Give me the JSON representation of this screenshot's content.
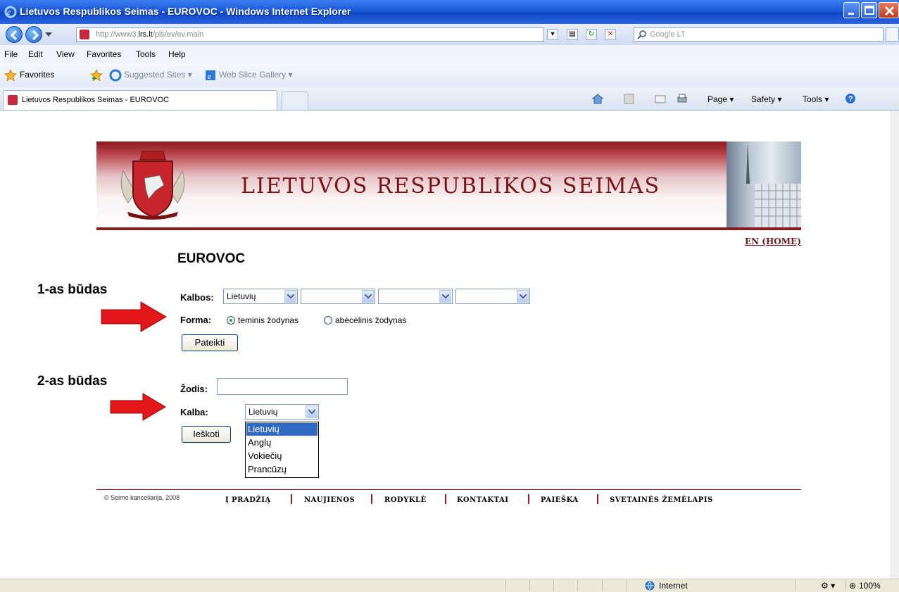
{
  "window": {
    "title": "Lietuvos Respublikos Seimas - EUROVOC - Windows Internet Explorer"
  },
  "address_bar": {
    "url_prefix": "http://www3.",
    "url_domain": "lrs.lt",
    "url_path": "/pls/ev/ev.main",
    "search_placeholder": "Google LT"
  },
  "menu": [
    "File",
    "Edit",
    "View",
    "Favorites",
    "Tools",
    "Help"
  ],
  "favorites_bar": {
    "favorites_label": "Favorites",
    "suggested_sites": "Suggested Sites ▾",
    "web_slice_gallery": "Web Slice Gallery ▾"
  },
  "tab": {
    "label": "Lietuvos Respublikos Seimas - EUROVOC"
  },
  "command_bar": {
    "page": "Page ▾",
    "safety": "Safety ▾",
    "tools": "Tools ▾"
  },
  "page": {
    "banner_title": "LIETUVOS RESPUBLIKOS SEIMAS",
    "en_link": "EN (HOME)",
    "heading": "EUROVOC",
    "method1_label": "1-as būdas",
    "method2_label": "2-as būdas",
    "form1": {
      "kalbos_label": "Kalbos:",
      "lang_selects": [
        "Lietuvių",
        "",
        "",
        ""
      ],
      "forma_label": "Forma:",
      "radio_options": [
        {
          "label": "teminis žodynas",
          "checked": true
        },
        {
          "label": "abėcėlinis žodynas",
          "checked": false
        }
      ],
      "submit_label": "Pateikti"
    },
    "form2": {
      "zodis_label": "Žodis:",
      "zodis_value": "",
      "kalba_label": "Kalba:",
      "kalba_selected": "Lietuvių",
      "kalba_options": [
        "Lietuvių",
        "Anglų",
        "Vokiečių",
        "Prancūzų"
      ],
      "search_label": "Ieškoti"
    },
    "footer": {
      "copyright": "© Seimo kanceliarija, 2008",
      "links": [
        "Į PRADŽIĄ",
        "NAUJIENOS",
        "RODYKLĖ",
        "KONTAKTAI",
        "PAIEŠKA",
        "SVETAINĖS ŽEMĖLAPIS"
      ]
    }
  },
  "status_bar": {
    "zone": "Internet",
    "zoom": "100%"
  }
}
